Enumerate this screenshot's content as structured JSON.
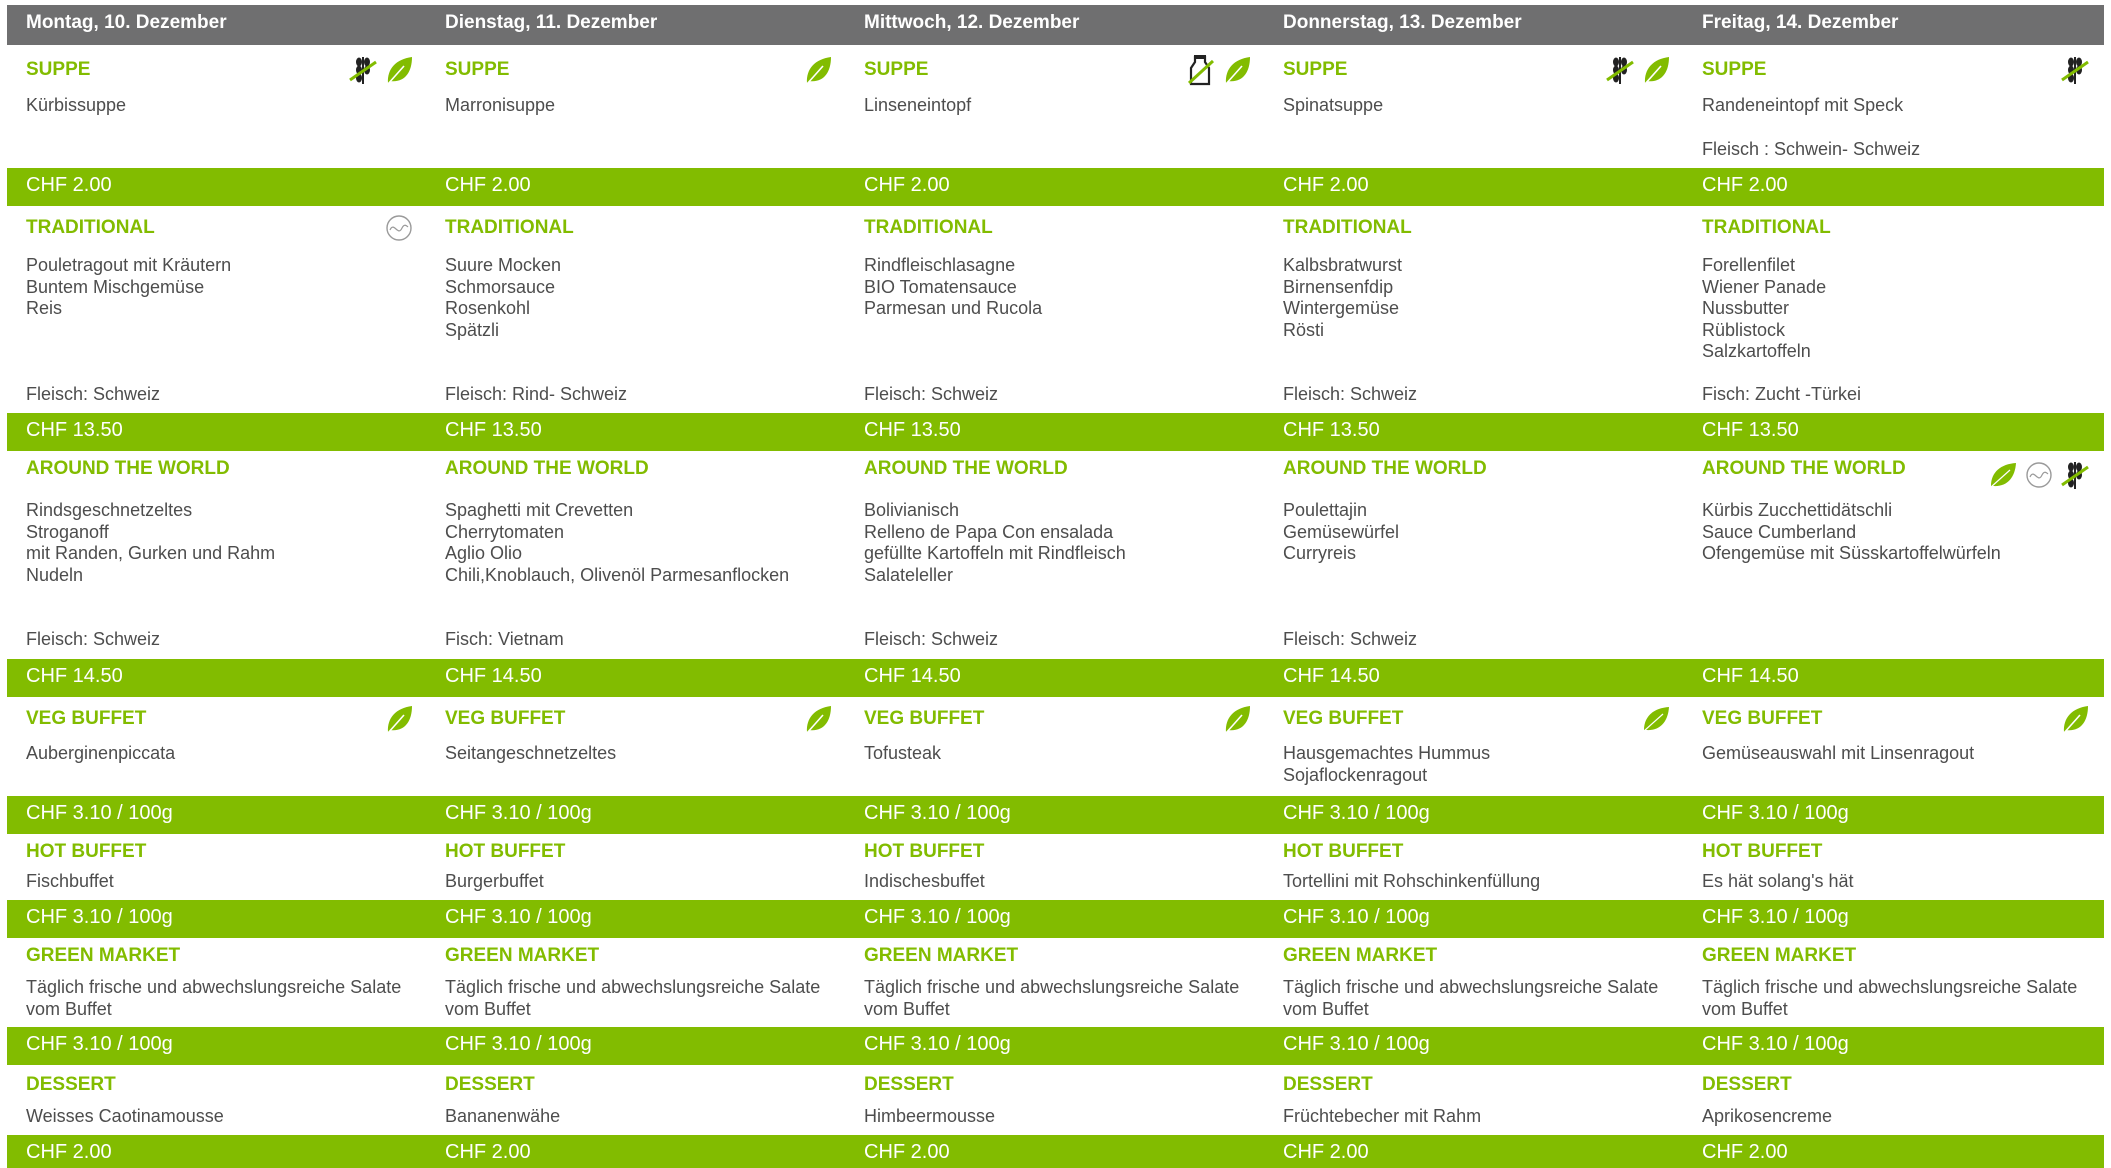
{
  "days": [
    {
      "header": "Montag, 10. Dezember",
      "suppe": {
        "category": "SUPPE",
        "lines": [
          "Kürbissuppe"
        ],
        "origin": "",
        "price": "CHF 2.00",
        "icons": [
          "no-gluten-icon",
          "vegetarian-leaf-icon"
        ]
      },
      "traditional": {
        "category": "TRADITIONAL",
        "lines": [
          "Pouletragout mit Kräutern",
          "Buntem Mischgemüse",
          "Reis"
        ],
        "origin": "Fleisch: Schweiz",
        "price": "CHF 13.50",
        "icons": [
          "balance-icon"
        ]
      },
      "world": {
        "category": "AROUND THE WORLD",
        "lines": [
          "Rindsgeschnetzeltes",
          "Stroganoff",
          "mit Randen, Gurken und Rahm",
          "Nudeln"
        ],
        "origin": "Fleisch: Schweiz",
        "price": "CHF 14.50",
        "icons": []
      },
      "veg": {
        "category": "VEG BUFFET",
        "lines": [
          "Auberginenpiccata"
        ],
        "price": "CHF 3.10 / 100g",
        "icons": [
          "vegetarian-leaf-icon"
        ]
      },
      "hot": {
        "category": "HOT BUFFET",
        "lines": [
          "Fischbuffet"
        ],
        "price": "CHF 3.10 / 100g"
      },
      "green": {
        "category": "GREEN MARKET",
        "lines": [
          "Täglich frische und abwechslungsreiche Salate",
          "vom Buffet"
        ],
        "price": "CHF 3.10 / 100g"
      },
      "dessert": {
        "category": "DESSERT",
        "lines": [
          "Weisses Caotinamousse"
        ],
        "price": "CHF 2.00"
      }
    },
    {
      "header": "Dienstag, 11. Dezember",
      "suppe": {
        "category": "SUPPE",
        "lines": [
          "Marronisuppe"
        ],
        "origin": "",
        "price": "CHF 2.00",
        "icons": [
          "vegetarian-leaf-icon"
        ]
      },
      "traditional": {
        "category": "TRADITIONAL",
        "lines": [
          "Suure Mocken",
          "Schmorsauce",
          "Rosenkohl",
          "Spätzli"
        ],
        "origin": "Fleisch: Rind- Schweiz",
        "price": "CHF 13.50",
        "icons": []
      },
      "world": {
        "category": "AROUND THE WORLD",
        "lines": [
          "Spaghetti mit Crevetten",
          "Cherrytomaten",
          "Aglio Olio",
          "Chili,Knoblauch, Olivenöl Parmesanflocken"
        ],
        "origin": "Fisch: Vietnam",
        "price": "CHF 14.50",
        "icons": []
      },
      "veg": {
        "category": "VEG BUFFET",
        "lines": [
          "Seitangeschnetzeltes"
        ],
        "price": "CHF 3.10 / 100g",
        "icons": [
          "vegetarian-leaf-icon"
        ]
      },
      "hot": {
        "category": "HOT BUFFET",
        "lines": [
          "Burgerbuffet"
        ],
        "price": "CHF 3.10 / 100g"
      },
      "green": {
        "category": "GREEN MARKET",
        "lines": [
          "Täglich frische und abwechslungsreiche Salate",
          "vom Buffet"
        ],
        "price": "CHF 3.10 / 100g"
      },
      "dessert": {
        "category": "DESSERT",
        "lines": [
          "Bananenwähe"
        ],
        "price": "CHF 2.00"
      }
    },
    {
      "header": "Mittwoch, 12. Dezember",
      "suppe": {
        "category": "SUPPE",
        "lines": [
          "Linseneintopf"
        ],
        "origin": "",
        "price": "CHF 2.00",
        "icons": [
          "no-lactose-icon",
          "vegetarian-leaf-icon"
        ]
      },
      "traditional": {
        "category": "TRADITIONAL",
        "lines": [
          "Rindfleischlasagne",
          "BIO Tomatensauce",
          "Parmesan und Rucola"
        ],
        "origin": "Fleisch: Schweiz",
        "price": "CHF 13.50",
        "icons": []
      },
      "world": {
        "category": "AROUND THE WORLD",
        "lines": [
          "Bolivianisch",
          "Relleno de Papa Con ensalada",
          "gefüllte Kartoffeln mit Rindfleisch",
          "Salateleller"
        ],
        "origin": "Fleisch: Schweiz",
        "price": "CHF 14.50",
        "icons": []
      },
      "veg": {
        "category": "VEG BUFFET",
        "lines": [
          "Tofusteak"
        ],
        "price": "CHF 3.10 / 100g",
        "icons": [
          "vegetarian-leaf-icon"
        ]
      },
      "hot": {
        "category": "HOT BUFFET",
        "lines": [
          "Indischesbuffet"
        ],
        "price": "CHF 3.10 / 100g"
      },
      "green": {
        "category": "GREEN MARKET",
        "lines": [
          "Täglich frische und abwechslungsreiche Salate",
          "vom Buffet"
        ],
        "price": "CHF 3.10 / 100g"
      },
      "dessert": {
        "category": "DESSERT",
        "lines": [
          "Himbeermousse"
        ],
        "price": "CHF 2.00"
      }
    },
    {
      "header": "Donnerstag, 13. Dezember",
      "suppe": {
        "category": "SUPPE",
        "lines": [
          "Spinatsuppe"
        ],
        "origin": "",
        "price": "CHF 2.00",
        "icons": [
          "no-gluten-icon",
          "vegetarian-leaf-icon"
        ]
      },
      "traditional": {
        "category": "TRADITIONAL",
        "lines": [
          "Kalbsbratwurst",
          "Birnensenfdip",
          "Wintergemüse",
          "Rösti"
        ],
        "origin": "Fleisch: Schweiz",
        "price": "CHF 13.50",
        "icons": []
      },
      "world": {
        "category": "AROUND THE WORLD",
        "lines": [
          "Poulettajin",
          "Gemüsewürfel",
          "Curryreis"
        ],
        "origin": "Fleisch: Schweiz",
        "price": "CHF 14.50",
        "icons": []
      },
      "veg": {
        "category": "VEG BUFFET",
        "lines": [
          "Hausgemachtes Hummus",
          "Sojaflockenragout"
        ],
        "price": "CHF 3.10 / 100g",
        "icons": [
          "vegan-leaf-icon"
        ]
      },
      "hot": {
        "category": "HOT BUFFET",
        "lines": [
          "Tortellini mit Rohschinkenfüllung"
        ],
        "price": "CHF 3.10 / 100g"
      },
      "green": {
        "category": "GREEN MARKET",
        "lines": [
          "Täglich frische und abwechslungsreiche Salate",
          "vom Buffet"
        ],
        "price": "CHF 3.10 / 100g"
      },
      "dessert": {
        "category": "DESSERT",
        "lines": [
          "Früchtebecher mit Rahm"
        ],
        "price": "CHF 2.00"
      }
    },
    {
      "header": "Freitag, 14. Dezember",
      "suppe": {
        "category": "SUPPE",
        "lines": [
          "Randeneintopf mit Speck"
        ],
        "origin": "Fleisch : Schwein- Schweiz",
        "price": "CHF 2.00",
        "icons": [
          "no-gluten-icon"
        ]
      },
      "traditional": {
        "category": "TRADITIONAL",
        "lines": [
          "Forellenfilet",
          "Wiener Panade",
          "Nussbutter",
          "Rüblistock",
          "Salzkartoffeln"
        ],
        "origin": "Fisch: Zucht -Türkei",
        "price": "CHF 13.50",
        "icons": []
      },
      "world": {
        "category": "AROUND THE WORLD",
        "lines": [
          "Kürbis Zucchettidätschli",
          "Sauce Cumberland",
          "Ofengemüse mit Süsskartoffelwürfeln"
        ],
        "origin": "",
        "price": "CHF 14.50",
        "icons": [
          "vegan-leaf-icon",
          "balance-icon",
          "no-gluten-icon"
        ]
      },
      "veg": {
        "category": "VEG BUFFET",
        "lines": [
          "Gemüseauswahl mit Linsenragout"
        ],
        "price": "CHF 3.10 / 100g",
        "icons": [
          "vegetarian-leaf-icon"
        ]
      },
      "hot": {
        "category": "HOT BUFFET",
        "lines": [
          "Es hät solang's hät"
        ],
        "price": "CHF 3.10 / 100g"
      },
      "green": {
        "category": "GREEN MARKET",
        "lines": [
          "Täglich frische und abwechslungsreiche Salate",
          "vom Buffet"
        ],
        "price": "CHF 3.10 / 100g"
      },
      "dessert": {
        "category": "DESSERT",
        "lines": [
          "Aprikosencreme"
        ],
        "price": "CHF 2.00"
      }
    }
  ],
  "colors": {
    "header_bg": "#6f6f70",
    "accent_green": "#82bc00",
    "body_text": "#4d4d4d",
    "icon_dark": "#222222"
  }
}
